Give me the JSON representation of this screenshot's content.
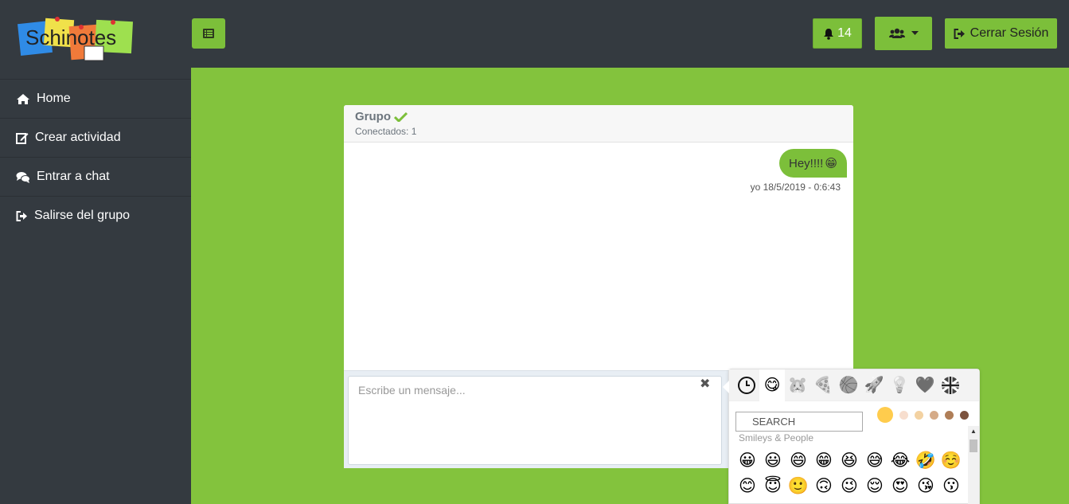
{
  "brand": {
    "logo_text": "Schinotes"
  },
  "header": {
    "notifications_count": "14",
    "logout_label": "Cerrar Sesión"
  },
  "sidebar": {
    "items": [
      {
        "label": "Home",
        "icon": "home-icon"
      },
      {
        "label": "Crear actividad",
        "icon": "edit-icon"
      },
      {
        "label": "Entrar a chat",
        "icon": "comments-icon"
      },
      {
        "label": "Salirse del grupo",
        "icon": "sign-out-icon"
      }
    ]
  },
  "chat": {
    "title": "Grupo",
    "connected": "Conectados: 1",
    "messages": [
      {
        "text": "Hey!!!!",
        "emoji": "😁",
        "meta": "yo 18/5/2019 - 0:6:43"
      }
    ],
    "input_placeholder": "Escribe un mensaje..."
  },
  "emoji_picker": {
    "categories": [
      "🕒",
      "😋",
      "🐹",
      "🍕",
      "🏀",
      "🚀",
      "💡",
      "🖤",
      "🇬🇧"
    ],
    "search_placeholder": "SEARCH",
    "category_label": "Smileys & People",
    "tones": [
      "#ffcc4d",
      "#f7dece",
      "#f3d2a2",
      "#d5ab88",
      "#af7e57",
      "#7c533e"
    ],
    "emojis": [
      "😀",
      "😃",
      "😄",
      "😁",
      "😆",
      "😅",
      "😂",
      "🤣",
      "☺️",
      "😊",
      "😇",
      "🙂",
      "🙃",
      "😉",
      "😌",
      "😍",
      "😘",
      "😗"
    ]
  },
  "colors": {
    "accent": "#7cbf3a",
    "background": "#83c33d",
    "sidebar": "#343a40"
  }
}
